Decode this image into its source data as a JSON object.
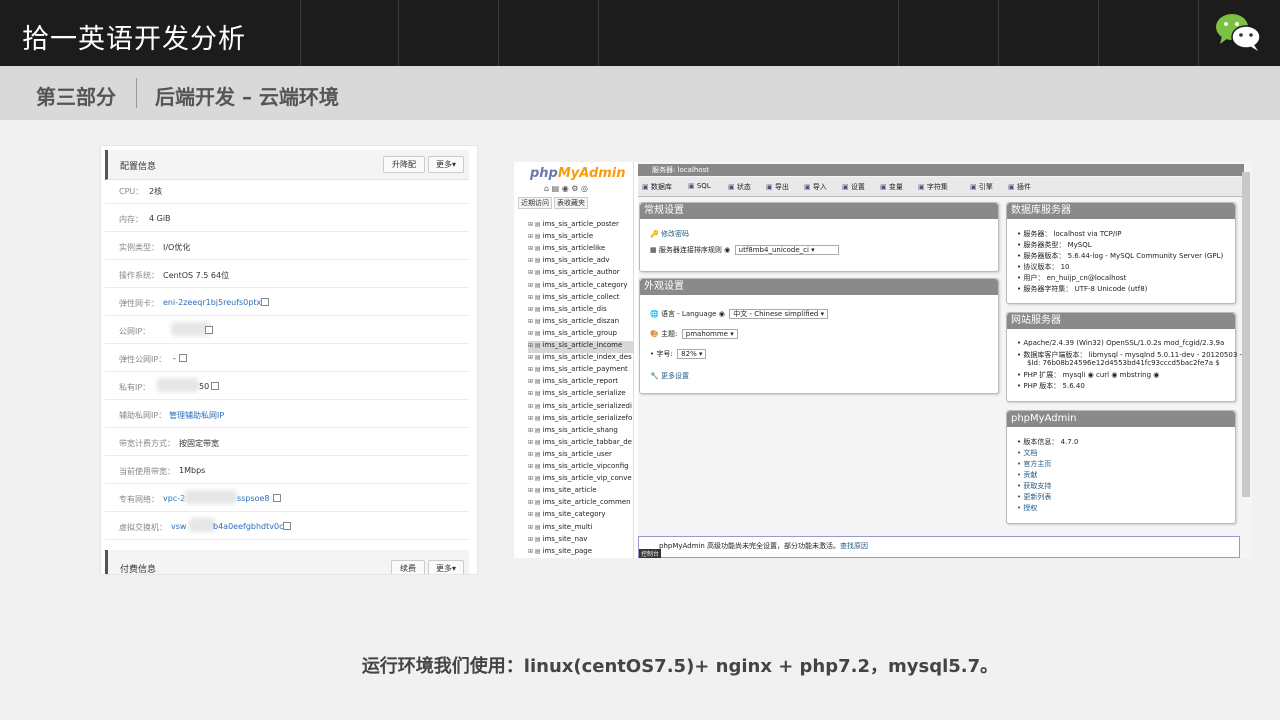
{
  "header": {
    "title": "拾一英语开发分析",
    "section": "第三部分",
    "subsection": "后端开发 – 云端环境"
  },
  "console": {
    "config_title": "配置信息",
    "upgrade_btn": "升降配",
    "more_btn": "更多▾",
    "rows": [
      {
        "key": "CPU：",
        "value": "2核"
      },
      {
        "key": "内存：",
        "value": "4 GiB"
      },
      {
        "key": "实例类型：",
        "value": "I/O优化"
      },
      {
        "key": "操作系统：",
        "value": "CentOS 7.5 64位"
      },
      {
        "key": "弹性网卡：",
        "value": "eni-2zeeqr1bj5reufs0ptxe"
      },
      {
        "key": "公网IP：",
        "value": ""
      },
      {
        "key": "弹性公网IP：",
        "value": "-"
      },
      {
        "key": "私有IP：",
        "value": "50"
      },
      {
        "key": "辅助私网IP：",
        "value": "管理辅助私网IP"
      },
      {
        "key": "带宽计费方式：",
        "value": "按固定带宽"
      },
      {
        "key": "当前使用带宽：",
        "value": "1Mbps"
      },
      {
        "key": "专有网络：",
        "value": "vpc-2"
      },
      {
        "key": "虚拟交换机：",
        "value": "vsw"
      }
    ],
    "vpc_suffix": "sspsoe8",
    "vsw_suffix": "b4a0eefgbhdtv0c",
    "billing_title": "付费信息",
    "renew_btn": "续费",
    "more_btn2": "更多▾"
  },
  "pma": {
    "logo_php": "php",
    "logo_my": "MyAdmin",
    "nav_tabs": [
      "近期访问",
      "表收藏夹"
    ],
    "tables": [
      "ims_sis_article_poster",
      "ims_sis_article",
      "ims_sis_articlelike",
      "ims_sis_article_adv",
      "ims_sis_article_author",
      "ims_sis_article_category",
      "ims_sis_article_collect",
      "ims_sis_article_dis",
      "ims_sis_article_diszan",
      "ims_sis_article_group",
      "ims_sis_article_income",
      "ims_sis_article_index_des",
      "ims_sis_article_payment",
      "ims_sis_article_report",
      "ims_sis_article_serialize",
      "ims_sis_article_serializedi",
      "ims_sis_article_serializefo",
      "ims_sis_article_shang",
      "ims_sis_article_tabbar_de",
      "ims_sis_article_user",
      "ims_sis_article_vipconfig",
      "ims_sis_article_vip_conve",
      "ims_site_article",
      "ims_site_article_commen",
      "ims_site_category",
      "ims_site_multi",
      "ims_site_nav",
      "ims_site_page"
    ],
    "topbar": "服务器: localhost",
    "menu": [
      "数据库",
      "SQL",
      "状态",
      "导出",
      "导入",
      "设置",
      "变量",
      "字符集",
      "引擎",
      "插件"
    ],
    "general": {
      "title": "常规设置",
      "change_pw": "修改密码",
      "collation_label": "服务器连接排序规则",
      "collation_value": "utf8mb4_unicode_ci ▾"
    },
    "appearance": {
      "title": "外观设置",
      "lang_label": "语言 - Language",
      "lang_value": "中文 - Chinese simplified ▾",
      "theme_label": "主题:",
      "theme_value": "pmahomme ▾",
      "font_label": "字号:",
      "font_value": "82% ▾",
      "more": "更多设置"
    },
    "db_server": {
      "title": "数据库服务器",
      "items": [
        "服务器： localhost via TCP/IP",
        "服务器类型： MySQL",
        "服务器版本： 5.6.44-log - MySQL Community Server (GPL)",
        "协议版本： 10",
        "用户： en_huijp_cn@localhost",
        "服务器字符集： UTF-8 Unicode (utf8)"
      ]
    },
    "web_server": {
      "title": "网站服务器",
      "items": [
        "Apache/2.4.39 (Win32) OpenSSL/1.0.2s mod_fcgid/2.3.9a",
        "数据库客户端版本： libmysql - mysqlnd 5.0.11-dev - 20120503 -",
        "$Id: 76b08b24596e12d4553bd41fc93cccd5bac2fe7a $",
        "PHP 扩展： mysqli ◉ curl ◉ mbstring ◉",
        "PHP 版本： 5.6.40"
      ]
    },
    "pma_info": {
      "title": "phpMyAdmin",
      "version": "版本信息： 4.7.0",
      "links": [
        "文档",
        "官方主页",
        "贡献",
        "获取支持",
        "更新列表",
        "授权"
      ]
    },
    "console_msg": "phpMyAdmin 高级功能尚未完全设置，部分功能未激活。",
    "console_link": "查找原因",
    "console_tag": "控制台"
  },
  "caption": "运行环境我们使用：linux(centOS7.5)+ nginx + php7.2，mysql5.7。",
  "colors": {
    "topbar": "#1c1c1c",
    "section_bar": "#d9d9d9",
    "pma_panel_header": "#8a8a8a",
    "link": "#2a6ebb"
  }
}
